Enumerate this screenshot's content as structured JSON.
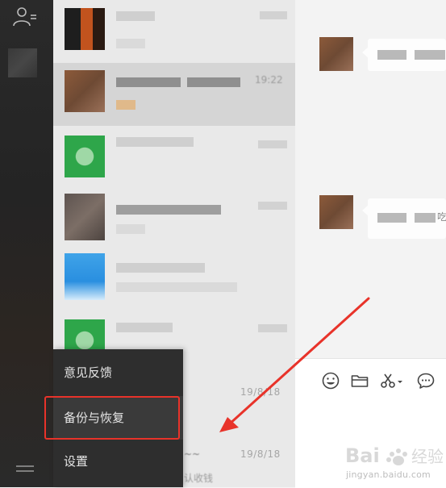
{
  "menu": {
    "items": [
      {
        "label": "意见反馈"
      },
      {
        "label": "备份与恢复"
      },
      {
        "label": "设置"
      }
    ]
  },
  "chat_list": {
    "dates": [
      "19/8/18",
      "19/8/18"
    ],
    "partial_time": "19:22",
    "partial_tilde": "~~",
    "partial_snippet": "认收钱"
  },
  "conversation": {
    "partial_text": "吃"
  },
  "watermark": {
    "brand": "Bai 经验",
    "url": "jingyan.baidu.com"
  },
  "colors": {
    "annotation": "#e8332a",
    "nav_bg": "#2a2a2a",
    "menu_bg": "#2e2e2e",
    "list_bg": "#e9e9e9",
    "wechat_green": "#2ea64a"
  }
}
